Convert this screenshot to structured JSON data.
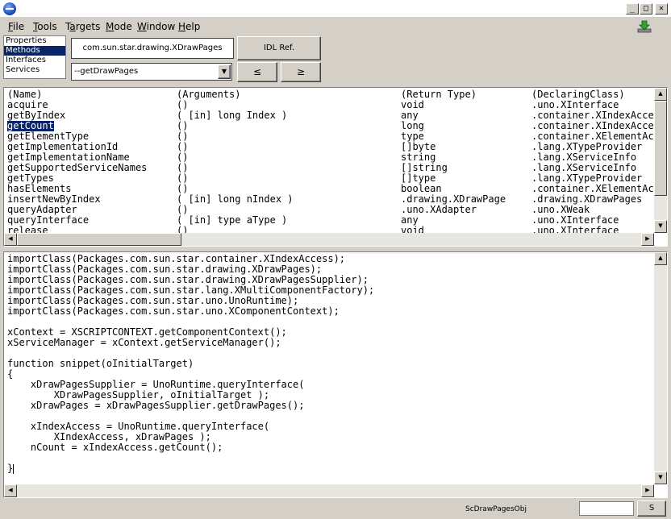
{
  "window": {
    "minimize_glyph": "_",
    "maximize_glyph": "□",
    "close_glyph": "✕"
  },
  "menu": [
    {
      "label": "File",
      "accel": "F",
      "rest": "ile"
    },
    {
      "label": "Tools",
      "accel": "T",
      "rest": "ools"
    },
    {
      "label": "Targets",
      "accel": "a",
      "pre": "T",
      "rest": "rgets"
    },
    {
      "label": "Mode",
      "accel": "M",
      "rest": "ode"
    },
    {
      "label": "Window",
      "accel": "W",
      "rest": "indow"
    },
    {
      "label": "Help",
      "accel": "H",
      "rest": "elp"
    }
  ],
  "categories": [
    {
      "label": "Properties",
      "selected": false
    },
    {
      "label": "Methods",
      "selected": true
    },
    {
      "label": "Interfaces",
      "selected": false
    },
    {
      "label": "Services",
      "selected": false
    }
  ],
  "interface_name": "com.sun.star.drawing.XDrawPages",
  "idl_button": "IDL Ref.",
  "method_combo_value": "--getDrawPages",
  "nav": {
    "prev": "≤",
    "next": "≥"
  },
  "methods_table": {
    "headers": [
      "(Name)",
      "(Arguments)",
      "(Return Type)",
      "(DeclaringClass)"
    ],
    "rows": [
      {
        "name": "acquire",
        "args": "()",
        "ret": "void",
        "decl": ".uno.XInterface"
      },
      {
        "name": "getByIndex",
        "args": "( [in] long Index )",
        "ret": "any",
        "decl": ".container.XIndexAccess"
      },
      {
        "name": "getCount",
        "args": "()",
        "ret": "long",
        "decl": ".container.XIndexAccess",
        "selected": true
      },
      {
        "name": "getElementType",
        "args": "()",
        "ret": "type",
        "decl": ".container.XElementAccess"
      },
      {
        "name": "getImplementationId",
        "args": "()",
        "ret": "[]byte",
        "decl": ".lang.XTypeProvider"
      },
      {
        "name": "getImplementationName",
        "args": "()",
        "ret": "string",
        "decl": ".lang.XServiceInfo"
      },
      {
        "name": "getSupportedServiceNames",
        "args": "()",
        "ret": "[]string",
        "decl": ".lang.XServiceInfo"
      },
      {
        "name": "getTypes",
        "args": "()",
        "ret": "[]type",
        "decl": ".lang.XTypeProvider"
      },
      {
        "name": "hasElements",
        "args": "()",
        "ret": "boolean",
        "decl": ".container.XElementAccess"
      },
      {
        "name": "insertNewByIndex",
        "args": "( [in] long nIndex )",
        "ret": ".drawing.XDrawPage",
        "decl": ".drawing.XDrawPages"
      },
      {
        "name": "queryAdapter",
        "args": "()",
        "ret": ".uno.XAdapter",
        "decl": ".uno.XWeak"
      },
      {
        "name": "queryInterface",
        "args": "( [in] type aType )",
        "ret": "any",
        "decl": ".uno.XInterface"
      },
      {
        "name": "release",
        "args": "()",
        "ret": "void",
        "decl": ".uno.XInterface"
      }
    ]
  },
  "code_lines": [
    "importClass(Packages.com.sun.star.container.XIndexAccess);",
    "importClass(Packages.com.sun.star.drawing.XDrawPages);",
    "importClass(Packages.com.sun.star.drawing.XDrawPagesSupplier);",
    "importClass(Packages.com.sun.star.lang.XMultiComponentFactory);",
    "importClass(Packages.com.sun.star.uno.UnoRuntime);",
    "importClass(Packages.com.sun.star.uno.XComponentContext);",
    "",
    "xContext = XSCRIPTCONTEXT.getComponentContext();",
    "xServiceManager = xContext.getServiceManager();",
    "",
    "function snippet(oInitialTarget)",
    "{",
    "    xDrawPagesSupplier = UnoRuntime.queryInterface(",
    "        XDrawPagesSupplier, oInitialTarget );",
    "    xDrawPages = xDrawPagesSupplier.getDrawPages();",
    "",
    "    xIndexAccess = UnoRuntime.queryInterface(",
    "        XIndexAccess, xDrawPages );",
    "    nCount = xIndexAccess.getCount();",
    "",
    "}"
  ],
  "status": {
    "object_name": "ScDrawPagesObj",
    "field_value": "",
    "s_button": "S"
  },
  "scroll_arrows": {
    "up": "▲",
    "down": "▼",
    "left": "◀",
    "right": "▶"
  }
}
